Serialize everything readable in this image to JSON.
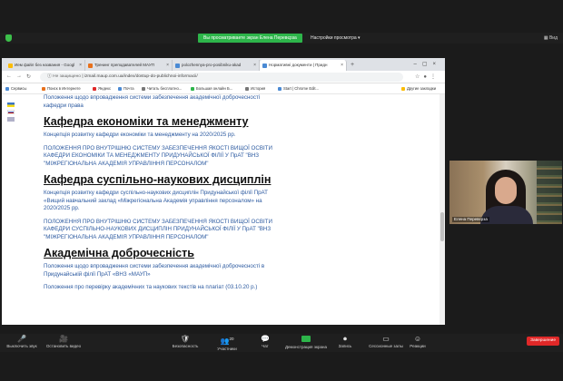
{
  "zoom": {
    "share_banner": "Вы просматриваете экран Елена Перевєрза",
    "view_settings": "Настройки просмотра ▾",
    "view_label": "Вид",
    "participant_name": "Елена Перевєрза",
    "toolbar": [
      {
        "icon": "🎤",
        "label": "Выключить звук",
        "name": "mute-button"
      },
      {
        "icon": "🎥",
        "label": "Остановить видео",
        "name": "stop-video-button"
      },
      {
        "icon": "🛡",
        "label": "Безопасность",
        "name": "security-button"
      },
      {
        "icon": "👥",
        "label": "Участники",
        "name": "participants-button"
      },
      {
        "icon": "💬",
        "label": "Чат",
        "name": "chat-button"
      },
      {
        "icon": "▣",
        "label": "Демонстрация экрана",
        "name": "share-screen-button"
      },
      {
        "icon": "⏺",
        "label": "Запись",
        "name": "record-button"
      },
      {
        "icon": "▭",
        "label": "Сессионные залы",
        "name": "breakout-rooms-button"
      },
      {
        "icon": "☺",
        "label": "Реакции",
        "name": "reactions-button"
      }
    ],
    "participants_count": "20",
    "end_label": "Завершение"
  },
  "browser": {
    "tabs": [
      {
        "title": "Ием файл без названия - Googl",
        "fav": "#fbbc05"
      },
      {
        "title": "Тренинг преподавателей МАУП",
        "fav": "#e8711c"
      },
      {
        "title": "polozhennya-pro-posibniku-akad",
        "fav": "#4a8ad4"
      },
      {
        "title": "Нормативні документи | Придн",
        "fav": "#4a8ad4"
      }
    ],
    "url_prefix": "Не защищено",
    "url": "izmail.maup.com.ua/index/dostup-do-publichnoi-informacii/",
    "bookmarks": [
      {
        "label": "Сервисы",
        "color": "#4a8ad4"
      },
      {
        "label": "Поиск в Интернете",
        "color": "#e8711c"
      },
      {
        "label": "Яндекс",
        "color": "#e02828"
      },
      {
        "label": "Почта",
        "color": "#4a8ad4"
      },
      {
        "label": "Читать бесплатно...",
        "color": "#777"
      },
      {
        "label": "Большая онлайн Б...",
        "color": "#2db54a"
      },
      {
        "label": "История",
        "color": "#777"
      },
      {
        "label": "Start | Chrome Edit...",
        "color": "#4a8ad4"
      },
      {
        "label": "Другие закладки",
        "color": "#fbbc05"
      }
    ]
  },
  "page": {
    "intro_line_1": "Положення щодо впровадження системи забезпечення академічної доброчесності",
    "intro_line_2": "кафедри права",
    "sections": [
      {
        "heading": "Кафедра економіки та менеджменту",
        "items": [
          [
            "Концепція розвитку кафедри економіки та менеджменту на 2020/2025 рр."
          ],
          [
            "ПОЛОЖЕННЯ ПРО ВНУТРІШНЮ СИСТЕМУ ЗАБЕЗПЕЧЕННЯ ЯКОСТІ ВИЩОЇ ОСВІТИ",
            "КАФЕДРИ ЕКОНОМІКИ ТА МЕНЕДЖМЕНТУ ПРИДУНАЙСЬКОЇ ФІЛІЇ У ПрАТ \"ВНЗ",
            "\"МІЖРЕГІОНАЛЬНА АКАДЕМІЯ УПРАВЛІННЯ ПЕРСОНАЛОМ\""
          ]
        ]
      },
      {
        "heading": "Кафедра суспільно-наукових дисциплін",
        "items": [
          [
            "Концепція розвитку кафедри суспільно-наукових дисциплін Придунайської філії ПрАТ",
            "«Вищий навчальний заклад «Міжрегіональна Академія управління персоналом» на",
            "2020/2025 рр."
          ],
          [
            "ПОЛОЖЕННЯ ПРО ВНУТРІШНЮ СИСТЕМУ ЗАБЕЗПЕЧЕННЯ ЯКОСТІ ВИЩОЇ ОСВІТИ",
            "КАФЕДРИ СУСПІЛЬНО-НАУКОВИХ ДИСЦИПЛІН ПРИДУНАЙСЬКОЇ ФІЛІЇ У ПрАТ \"ВНЗ",
            "\"МІЖРЕГІОНАЛЬНА АКАДЕМІЯ УПРАВЛІННЯ ПЕРСОНАЛОМ\""
          ]
        ]
      },
      {
        "heading": "Академічна доброчесність",
        "items": [
          [
            "Положення щодо впровадження системи забезпечення академічної доброчесності в",
            "Придунайській філії ПрАТ «ВНЗ «МАУП»"
          ],
          [
            "Положення про перевірку академічних та наукових текстів на плагіат (03.10.20 р.)"
          ]
        ]
      }
    ]
  },
  "colors": {
    "zoom_green": "#2db54a",
    "end_red": "#e02828",
    "link_blue": "#2c5aa0"
  }
}
